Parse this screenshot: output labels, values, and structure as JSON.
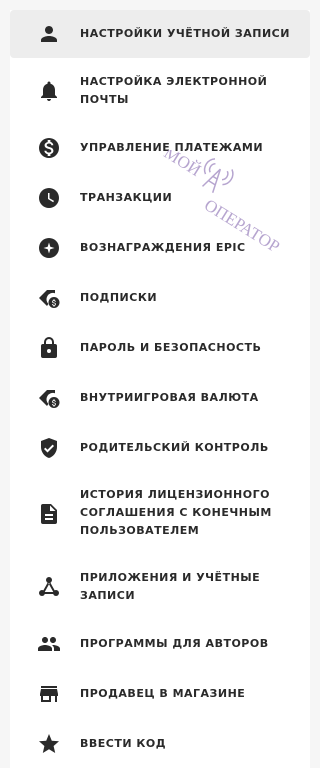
{
  "menu": {
    "items": [
      {
        "label": "НАСТРОЙКИ УЧЁТНОЙ ЗАПИСИ",
        "icon": "person-icon"
      },
      {
        "label": "НАСТРОЙКА ЭЛЕКТРОННОЙ ПОЧТЫ",
        "icon": "bell-icon"
      },
      {
        "label": "УПРАВЛЕНИЕ ПЛАТЕЖАМИ",
        "icon": "dollar-circle-icon"
      },
      {
        "label": "ТРАНЗАКЦИИ",
        "icon": "clock-icon"
      },
      {
        "label": "ВОЗНАГРАЖДЕНИЯ EPIC",
        "icon": "star-badge-icon"
      },
      {
        "label": "ПОДПИСКИ",
        "icon": "tag-dollar-icon"
      },
      {
        "label": "ПАРОЛЬ И БЕЗОПАСНОСТЬ",
        "icon": "lock-icon"
      },
      {
        "label": "ВНУТРИИГРОВАЯ ВАЛЮТА",
        "icon": "tag-coin-icon"
      },
      {
        "label": "РОДИТЕЛЬСКИЙ КОНТРОЛЬ",
        "icon": "shield-check-icon"
      },
      {
        "label": "ИСТОРИЯ ЛИЦЕНЗИОННОГО СОГЛАШЕНИЯ С КОНЕЧНЫМ ПОЛЬЗОВАТЕЛЕМ",
        "icon": "document-icon"
      },
      {
        "label": "ПРИЛОЖЕНИЯ И УЧЁТНЫЕ ЗАПИСИ",
        "icon": "share-nodes-icon"
      },
      {
        "label": "ПРОГРАММЫ ДЛЯ АВТОРОВ",
        "icon": "people-icon"
      },
      {
        "label": "ПРОДАВЕЦ В МАГАЗИНЕ",
        "icon": "store-icon"
      },
      {
        "label": "ВВЕСТИ КОД",
        "icon": "star-icon"
      }
    ]
  },
  "watermark": {
    "line1": "МОЙ",
    "line2": "ОПЕРАТОР"
  },
  "colors": {
    "text": "#2a2a2a",
    "active_bg": "#ededed",
    "watermark": "#a58fc4"
  }
}
